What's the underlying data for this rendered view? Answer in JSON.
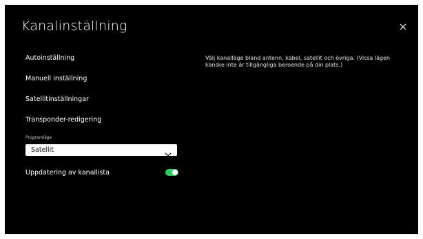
{
  "panel": {
    "title": "Kanalinställning"
  },
  "menu": {
    "items": [
      {
        "label": "Autoinställning"
      },
      {
        "label": "Manuell inställning"
      },
      {
        "label": "Satellitinställningar"
      },
      {
        "label": "Transponder-redigering"
      }
    ]
  },
  "program_mode": {
    "label": "Programläge",
    "selected_value": "Satellit"
  },
  "channel_list_update": {
    "label": "Uppdatering av kanallista",
    "enabled": true
  },
  "description": {
    "text": "Välj kanalläge bland antenn, kabel, satellit och övriga. (Vissa lägen kanske inte är tillgängliga beroende på din plats.)"
  },
  "icons": {
    "close": "close-icon",
    "dropdown": "chevron-down-icon"
  },
  "colors": {
    "background": "#000000",
    "toggle_on": "#2fcd63",
    "dropdown_bg": "#ffffff"
  }
}
